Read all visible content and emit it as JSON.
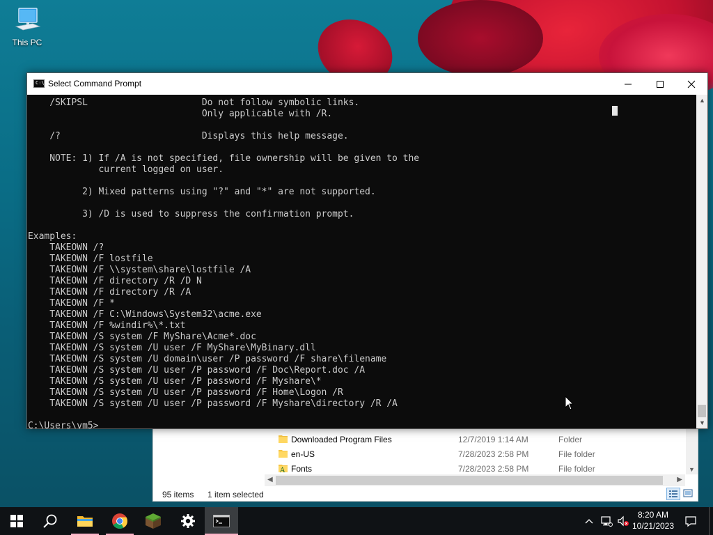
{
  "desktop": {
    "icons": [
      {
        "label": "This PC",
        "icon": "computer-icon"
      }
    ]
  },
  "cmd_window": {
    "title": "Select Command Prompt",
    "icon": "console-icon",
    "icon_text": "C:\\_",
    "controls": {
      "minimize": "minimize-icon",
      "maximize": "maximize-icon",
      "close": "close-icon"
    },
    "lines": [
      "    /SKIPSL                     Do not follow symbolic links.",
      "                                Only applicable with /R.",
      "",
      "    /?                          Displays this help message.",
      "",
      "    NOTE: 1) If /A is not specified, file ownership will be given to the",
      "             current logged on user.",
      "",
      "          2) Mixed patterns using \"?\" and \"*\" are not supported.",
      "",
      "          3) /D is used to suppress the confirmation prompt.",
      "",
      "Examples:",
      "    TAKEOWN /?",
      "    TAKEOWN /F lostfile",
      "    TAKEOWN /F \\\\system\\share\\lostfile /A",
      "    TAKEOWN /F directory /R /D N",
      "    TAKEOWN /F directory /R /A",
      "    TAKEOWN /F *",
      "    TAKEOWN /F C:\\Windows\\System32\\acme.exe",
      "    TAKEOWN /F %windir%\\*.txt",
      "    TAKEOWN /S system /F MyShare\\Acme*.doc",
      "    TAKEOWN /S system /U user /F MyShare\\MyBinary.dll",
      "    TAKEOWN /S system /U domain\\user /P password /F share\\filename",
      "    TAKEOWN /S system /U user /P password /F Doc\\Report.doc /A",
      "    TAKEOWN /S system /U user /P password /F Myshare\\*",
      "    TAKEOWN /S system /U user /P password /F Home\\Logon /R",
      "    TAKEOWN /S system /U user /P password /F Myshare\\directory /R /A",
      "",
      "C:\\Users\\vm5>"
    ]
  },
  "explorer": {
    "rows": [
      {
        "name": "Downloaded Program Files",
        "date": "12/7/2019 1:14 AM",
        "type": "Folder",
        "icon": "folder-icon"
      },
      {
        "name": "en-US",
        "date": "7/28/2023 2:58 PM",
        "type": "File folder",
        "icon": "folder-icon"
      },
      {
        "name": "Fonts",
        "date": "7/28/2023 2:58 PM",
        "type": "File folder",
        "icon": "fonts-folder-icon"
      }
    ],
    "status": {
      "item_count": "95 items",
      "selection": "1 item selected"
    }
  },
  "taskbar": {
    "apps": [
      {
        "name": "start",
        "icon": "windows-logo-icon"
      },
      {
        "name": "search",
        "icon": "search-icon"
      },
      {
        "name": "file-explorer",
        "icon": "folder-icon"
      },
      {
        "name": "chrome",
        "icon": "chrome-icon"
      },
      {
        "name": "minecraft",
        "icon": "grass-block-icon"
      },
      {
        "name": "settings",
        "icon": "gear-icon"
      },
      {
        "name": "command-prompt",
        "icon": "console-icon"
      }
    ],
    "clock": {
      "time": "8:20 AM",
      "date": "10/21/2023"
    }
  },
  "colors": {
    "console_bg": "#0c0c0c",
    "console_text": "#cccccc",
    "taskbar_bg": "#0f1215",
    "taskbar_indicator": "#ffb3c8"
  }
}
